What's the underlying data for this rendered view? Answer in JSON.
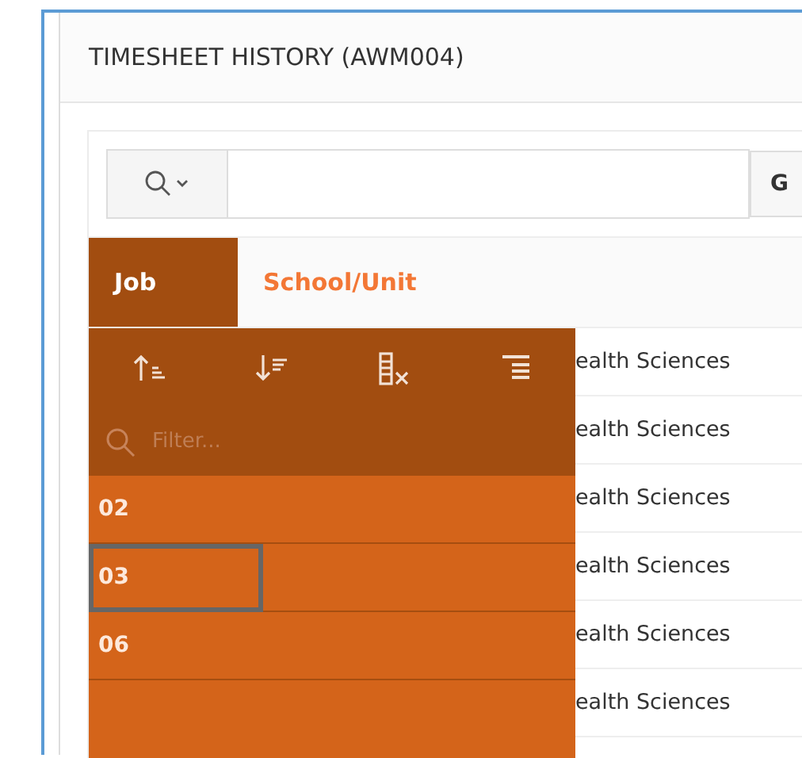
{
  "window": {
    "title": "TIMESHEET HISTORY (AWM004)"
  },
  "search": {
    "go_label": "G"
  },
  "columns": [
    {
      "label": "Job",
      "selected": true
    },
    {
      "label": "School/Unit",
      "selected": false
    }
  ],
  "column_menu": {
    "filter_placeholder": "Filter...",
    "values": [
      {
        "label": "02",
        "focused": false
      },
      {
        "label": "03",
        "focused": true
      },
      {
        "label": "06",
        "focused": false
      }
    ]
  },
  "rows": [
    "ealth Sciences",
    "ealth Sciences",
    "ealth Sciences",
    "ealth Sciences",
    "ealth Sciences",
    "ealth Sciences"
  ]
}
